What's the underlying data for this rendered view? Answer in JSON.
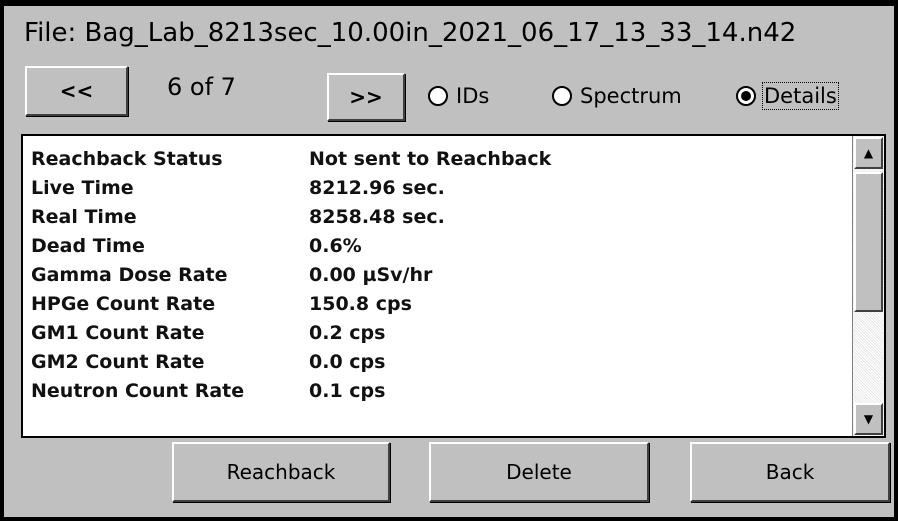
{
  "file": {
    "title": "File: Bag_Lab_8213sec_10.00in_2021_06_17_13_33_14.n42"
  },
  "nav": {
    "prev_label": "<<",
    "counter": "6 of 7",
    "next_label": ">>"
  },
  "view_options": [
    {
      "label": "IDs",
      "selected": false
    },
    {
      "label": "Spectrum",
      "selected": false
    },
    {
      "label": "Details",
      "selected": true
    }
  ],
  "details": {
    "rows": [
      {
        "key": "Reachback Status",
        "value": "Not sent to Reachback"
      },
      {
        "key": "Live Time",
        "value": "8212.96 sec."
      },
      {
        "key": "Real Time",
        "value": "8258.48 sec."
      },
      {
        "key": "Dead Time",
        "value": "0.6%"
      },
      {
        "key": "Gamma Dose Rate",
        "value": "0.00  µSv/hr"
      },
      {
        "key": "HPGe Count Rate",
        "value": "150.8 cps"
      },
      {
        "key": "GM1 Count Rate",
        "value": "0.2 cps"
      },
      {
        "key": "GM2 Count Rate",
        "value": "0.0 cps"
      },
      {
        "key": "Neutron Count Rate",
        "value": "0.1 cps"
      }
    ]
  },
  "actions": {
    "reachback_label": "Reachback",
    "delete_label": "Delete",
    "back_label": "Back"
  },
  "icons": {
    "scroll_up": "scroll-up-arrow-icon",
    "scroll_down": "scroll-down-arrow-icon"
  }
}
